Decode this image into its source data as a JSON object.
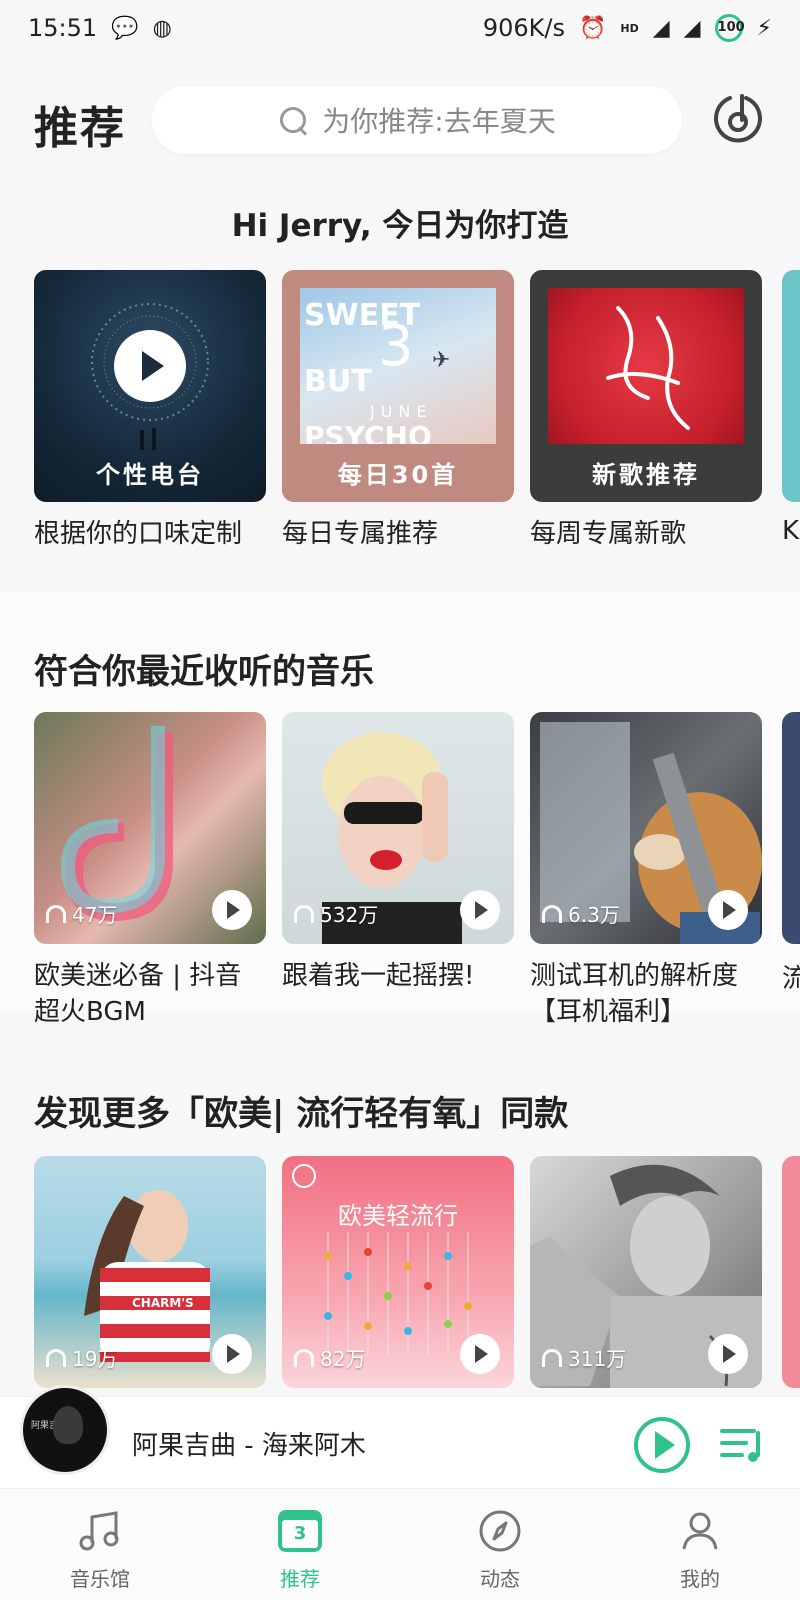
{
  "status_bar": {
    "time": "15:51",
    "net_speed": "906K/s",
    "hd_badge": "HD",
    "battery": "100"
  },
  "header": {
    "title": "推荐",
    "search_placeholder": "为你推荐:去年夏天"
  },
  "greeting": "Hi Jerry, 今日为你打造",
  "featured": [
    {
      "caption": "个性电台",
      "title": "根据你的口味定制"
    },
    {
      "caption": "每日30首",
      "title": "每日专属推荐",
      "cover_text": [
        "SWEET",
        "3",
        "BUT",
        "JUNE",
        "PSYCHO"
      ]
    },
    {
      "caption": "新歌推荐",
      "title": "每周专属新歌"
    },
    {
      "title": "K"
    }
  ],
  "section_recent": {
    "title": "符合你最近收听的音乐",
    "items": [
      {
        "plays": "47万",
        "title": "欧美迷必备 | 抖音超火BGM"
      },
      {
        "plays": "532万",
        "title": "跟着我一起摇摆!"
      },
      {
        "plays": "6.3万",
        "title": "测试耳机的解析度【耳机福利】"
      },
      {
        "title": "流"
      }
    ]
  },
  "section_discover": {
    "title": "发现更多「欧美| 流行轻有氧」同款",
    "items": [
      {
        "plays": "19万",
        "cover_text": "CHARM'S"
      },
      {
        "plays": "82万",
        "cover_text": "欧美轻流行"
      },
      {
        "plays": "311万"
      }
    ]
  },
  "player": {
    "track": "阿果吉曲 - 海来阿木",
    "avatar_text": "阿果吉曲"
  },
  "tabs": [
    {
      "label": "音乐馆",
      "icon": "music-note-icon"
    },
    {
      "label": "推荐",
      "icon": "calendar-icon",
      "badge": "3"
    },
    {
      "label": "动态",
      "icon": "compass-icon"
    },
    {
      "label": "我的",
      "icon": "person-icon"
    }
  ],
  "colors": {
    "accent": "#2fc38b",
    "background": "#f7f7f7"
  }
}
